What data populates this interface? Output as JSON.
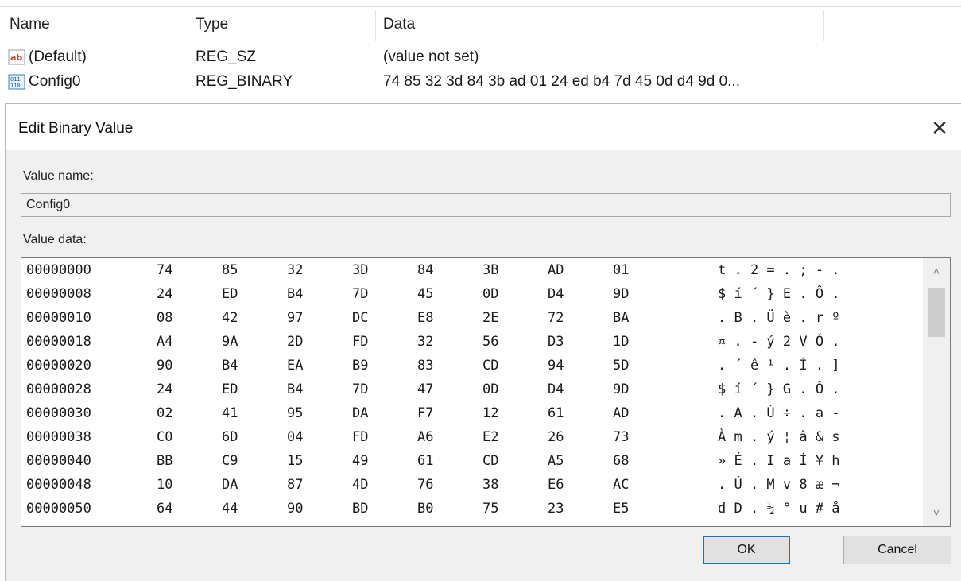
{
  "registry": {
    "headers": {
      "name": "Name",
      "type": "Type",
      "data": "Data"
    },
    "rows": [
      {
        "icon": "string-value-icon",
        "name": "(Default)",
        "type": "REG_SZ",
        "data": "(value not set)"
      },
      {
        "icon": "binary-value-icon",
        "name": "Config0",
        "type": "REG_BINARY",
        "data": "74 85 32 3d 84 3b ad 01 24 ed b4 7d 45 0d d4 9d 0..."
      }
    ]
  },
  "dialog": {
    "title": "Edit Binary Value",
    "close_glyph": "✕",
    "value_name_label": "Value name:",
    "value_name": "Config0",
    "value_data_label": "Value data:",
    "ok_label": "OK",
    "cancel_label": "Cancel"
  },
  "hex_rows": [
    {
      "addr": "00000000",
      "bytes": [
        "74",
        "85",
        "32",
        "3D",
        "84",
        "3B",
        "AD",
        "01"
      ],
      "ascii": "t . 2 = . ; - ."
    },
    {
      "addr": "00000008",
      "bytes": [
        "24",
        "ED",
        "B4",
        "7D",
        "45",
        "0D",
        "D4",
        "9D"
      ],
      "ascii": "$ í ´ } E . Ô ."
    },
    {
      "addr": "00000010",
      "bytes": [
        "08",
        "42",
        "97",
        "DC",
        "E8",
        "2E",
        "72",
        "BA"
      ],
      "ascii": ". B . Ü è . r º"
    },
    {
      "addr": "00000018",
      "bytes": [
        "A4",
        "9A",
        "2D",
        "FD",
        "32",
        "56",
        "D3",
        "1D"
      ],
      "ascii": "¤ . - ý 2 V Ó ."
    },
    {
      "addr": "00000020",
      "bytes": [
        "90",
        "B4",
        "EA",
        "B9",
        "83",
        "CD",
        "94",
        "5D"
      ],
      "ascii": ". ´ ê ¹ . Í . ]"
    },
    {
      "addr": "00000028",
      "bytes": [
        "24",
        "ED",
        "B4",
        "7D",
        "47",
        "0D",
        "D4",
        "9D"
      ],
      "ascii": "$ í ´ } G . Ô ."
    },
    {
      "addr": "00000030",
      "bytes": [
        "02",
        "41",
        "95",
        "DA",
        "F7",
        "12",
        "61",
        "AD"
      ],
      "ascii": ". A . Ú ÷ . a -"
    },
    {
      "addr": "00000038",
      "bytes": [
        "C0",
        "6D",
        "04",
        "FD",
        "A6",
        "E2",
        "26",
        "73"
      ],
      "ascii": "À m . ý ¦ â & s"
    },
    {
      "addr": "00000040",
      "bytes": [
        "BB",
        "C9",
        "15",
        "49",
        "61",
        "CD",
        "A5",
        "68"
      ],
      "ascii": "» É . I a Í ¥ h"
    },
    {
      "addr": "00000048",
      "bytes": [
        "10",
        "DA",
        "87",
        "4D",
        "76",
        "38",
        "E6",
        "AC"
      ],
      "ascii": ". Ú . M v 8 æ ¬"
    },
    {
      "addr": "00000050",
      "bytes": [
        "64",
        "44",
        "90",
        "BD",
        "B0",
        "75",
        "23",
        "E5"
      ],
      "ascii": "d D . ½ ° u # å"
    }
  ],
  "scroll": {
    "up_glyph": "˄",
    "down_glyph": "˅"
  }
}
